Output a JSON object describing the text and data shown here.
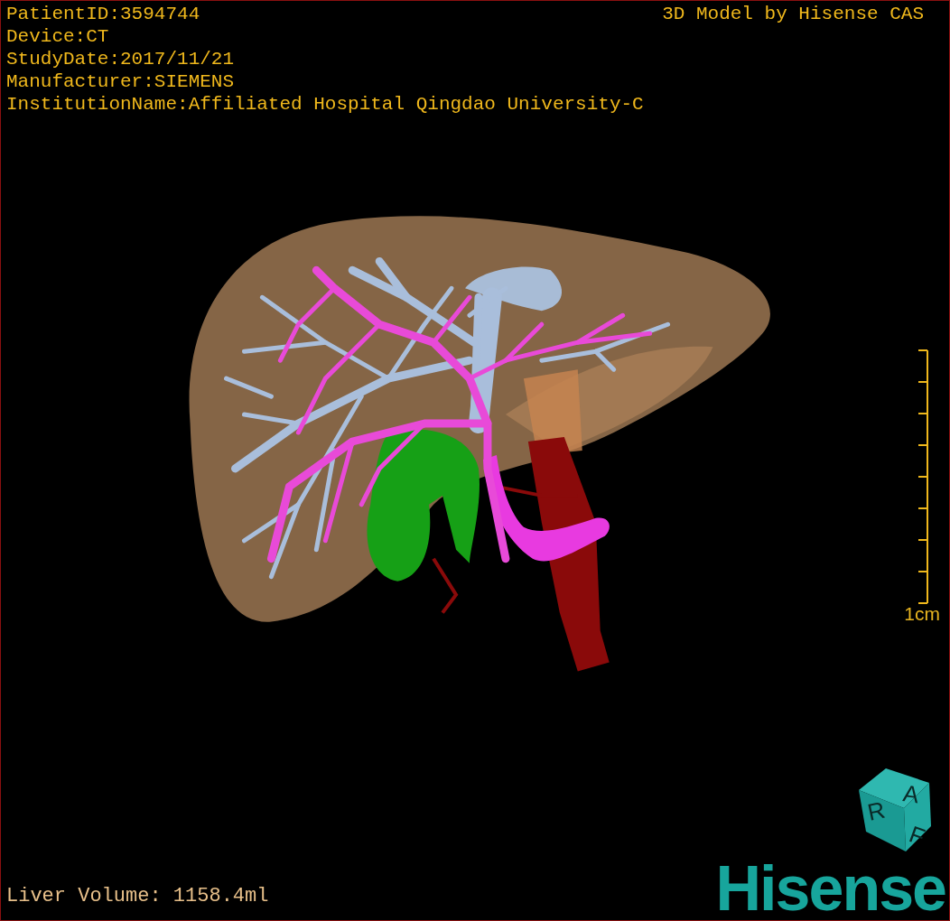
{
  "header": {
    "lines": [
      "PatientID:3594744",
      "Device:CT",
      "StudyDate:2017/11/21",
      "Manufacturer:SIEMENS",
      "InstitutionName:Affiliated Hospital Qingdao University-C"
    ],
    "credit": "3D Model by Hisense CAS"
  },
  "scale_bar": {
    "label": "1cm"
  },
  "measurement": "Liver Volume: 1158.4ml",
  "orientation_cube": {
    "faces": [
      "R",
      "A",
      "F"
    ]
  },
  "logo": "Hisense"
}
